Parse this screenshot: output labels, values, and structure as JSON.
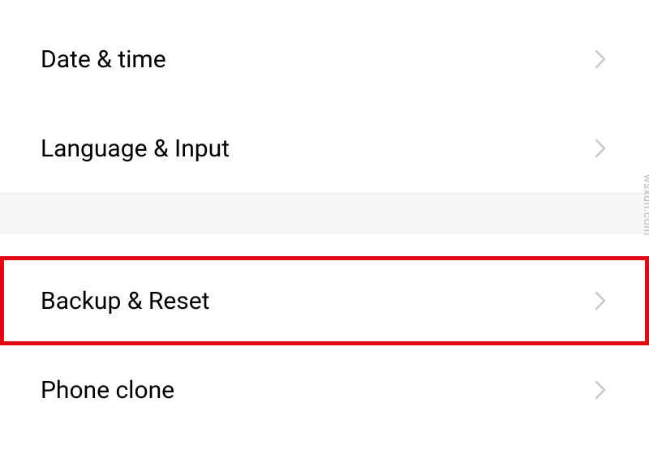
{
  "settings": {
    "group1": {
      "items": [
        {
          "label": "Date & time"
        },
        {
          "label": "Language & Input"
        }
      ]
    },
    "group2": {
      "items": [
        {
          "label": "Backup & Reset",
          "highlighted": true
        },
        {
          "label": "Phone clone"
        }
      ]
    }
  },
  "watermark": "wsxdn.com"
}
